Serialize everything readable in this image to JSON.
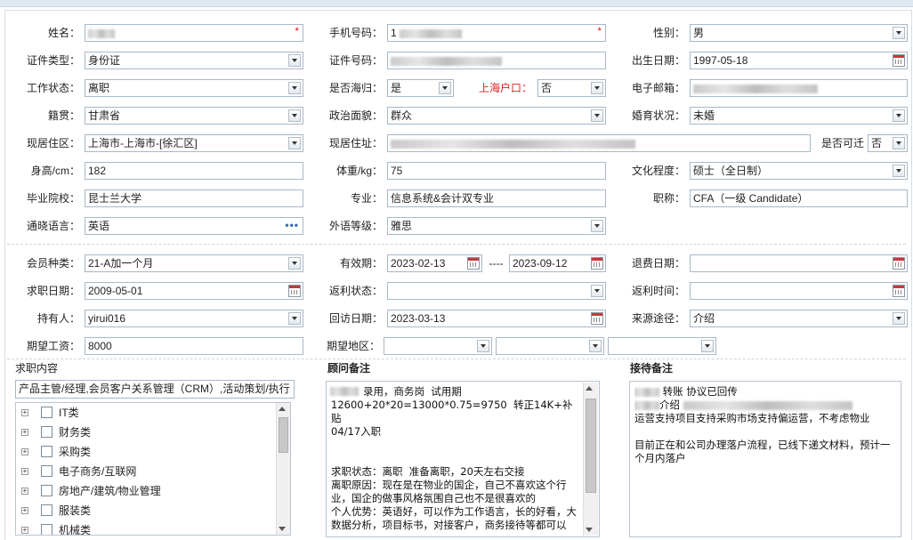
{
  "row1": {
    "name_label": "姓名：",
    "phone_label": "手机号码：",
    "phone_value": "1",
    "gender_label": "性别：",
    "gender_value": "男",
    "required_mark": "*"
  },
  "row2": {
    "idtype_label": "证件类型：",
    "idtype_value": "身份证",
    "idno_label": "证件号码：",
    "birth_label": "出生日期：",
    "birth_value": "1997-05-18"
  },
  "row3": {
    "workstatus_label": "工作状态：",
    "workstatus_value": "离职",
    "returnee_label": "是否海归：",
    "returnee_value": "是",
    "hukou_label": "上海户口：",
    "hukou_value": "否",
    "email_label": "电子邮箱："
  },
  "row4": {
    "native_label": "籍贯：",
    "native_value": "甘肃省",
    "political_label": "政治面貌：",
    "political_value": "群众",
    "marital_label": "婚育状况：",
    "marital_value": "未婚"
  },
  "row5": {
    "residence_label": "现居住区：",
    "residence_value": "上海市-上海市-[徐汇区]",
    "address_label": "现居住址：",
    "relocate_label": "是否可迁",
    "relocate_value": "否"
  },
  "row6": {
    "height_label": "身高/cm：",
    "height_value": "182",
    "weight_label": "体重/kg：",
    "weight_value": "75",
    "education_label": "文化程度：",
    "education_value": "硕士（全日制）"
  },
  "row7": {
    "school_label": "毕业院校：",
    "school_value": "昆士兰大学",
    "major_label": "专业：",
    "major_value": "信息系统&会计双专业",
    "title_label": "职称：",
    "title_value": "CFA（一级 Candidate）"
  },
  "row8": {
    "language_label": "通晓语言：",
    "language_value": "英语",
    "more_icon": "•••",
    "foreign_level_label": "外语等级：",
    "foreign_level_value": "雅思"
  },
  "member": {
    "type_label": "会员种类：",
    "type_value": "21-A加一个月",
    "valid_label": "有效期：",
    "valid_from": "2023-02-13",
    "valid_sep": "----",
    "valid_to": "2023-09-12",
    "refund_date_label": "退费日期：",
    "job_date_label": "求职日期：",
    "job_date_value": "2009-05-01",
    "rebate_status_label": "返利状态：",
    "rebate_time_label": "返利时间：",
    "holder_label": "持有人：",
    "holder_value": "yirui016",
    "visit_date_label": "回访日期：",
    "visit_date_value": "2023-03-13",
    "source_label": "来源途径：",
    "source_value": "介绍",
    "salary_label": "期望工资：",
    "salary_value": "8000",
    "region_label": "期望地区："
  },
  "job_content": {
    "header": "求职内容",
    "summary": "产品主管/经理,会员客户关系管理（CRM）,活动策划/执行",
    "categories": [
      "IT类",
      "财务类",
      "采购类",
      "电子商务/互联网",
      "房地产/建筑/物业管理",
      "服装类",
      "机械类"
    ]
  },
  "consultant_note": {
    "header": "顾问备注",
    "text": "录用，商务岗  试用期\n12600+20*20=13000*0.75=9750  转正14K+补贴\n04/17入职\n\n\n求职状态：离职  准备离职，20天左右交接\n离职原因：现在是在物业的国企，自己不喜欢这个行业，国企的做事风格氛围自己也不是很喜欢的\n个人优势：英语好，可以作为工作语言，长的好看，大数据分析，项目标书，对接客户，商务接待等都可以"
  },
  "reception_note": {
    "header": "接待备注",
    "line1": " 转账 协议已回传",
    "line2": "介绍",
    "line3": "运营支持项目支持采购市场支持偏运营，不考虑物业\n\n目前正在和公司办理落户流程，已线下递文材料，预计一个月内落户"
  },
  "icons": {
    "dropdown": "chevron-down-icon",
    "calendar": "calendar-icon",
    "expand": "plus-expand-icon"
  },
  "colors": {
    "required": "#e02020",
    "border": "#a9b7c6",
    "link_dots": "#3a66b5"
  }
}
